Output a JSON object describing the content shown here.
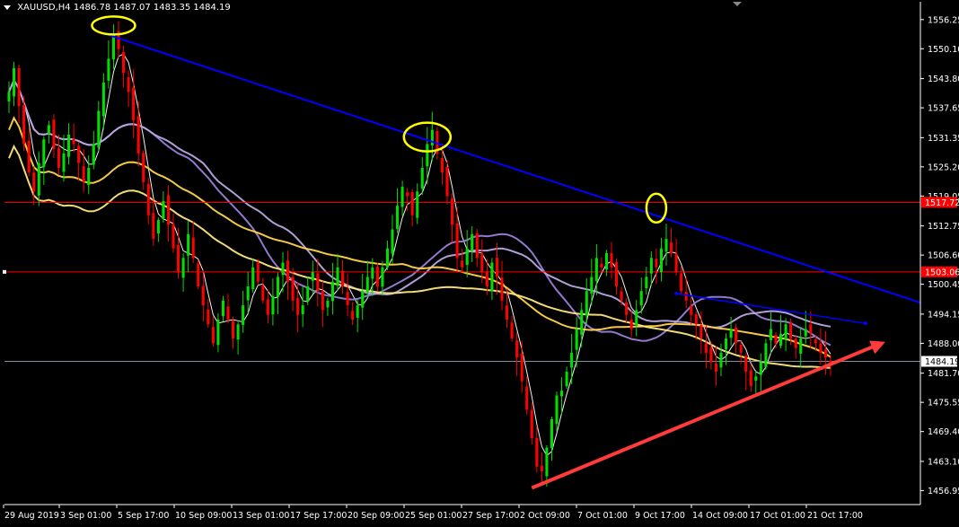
{
  "header": {
    "symbol": "XAUUSD,H4",
    "quote": "1486.78 1487.07 1483.35 1484.19"
  },
  "colors": {
    "background": "#000000",
    "axis": "#ffffff",
    "bull_candle": "#00e000",
    "bear_candle": "#ff0000",
    "resistance_line": "#0000ff",
    "support_arrow": "#ff3b3b",
    "horizontal_level": "#ff0000",
    "current_price_line": "#7f8c9c",
    "highlight_ellipse": "#ffff00",
    "ma_fast": "#ffffff",
    "ma_purple": "#9b7fd8",
    "ma_lavender": "#b9a8e0",
    "ma_gold": "#ffd54a",
    "ma_yellow": "#ffe680"
  },
  "chart_data": {
    "type": "candlestick",
    "symbol": "XAUUSD",
    "timeframe": "H4",
    "ylim": [
      1454.0,
      1560.0
    ],
    "y_ticks": [
      "1556.25",
      "1550.10",
      "1543.80",
      "1537.65",
      "1531.35",
      "1525.20",
      "1519.05",
      "1512.75",
      "1506.60",
      "1500.45",
      "1494.15",
      "1488.00",
      "1481.70",
      "1475.55",
      "1469.40",
      "1463.10",
      "1456.95"
    ],
    "x_ticks": [
      "29 Aug 2019",
      "3 Sep 01:00",
      "5 Sep 17:00",
      "10 Sep 09:00",
      "13 Sep 01:00",
      "17 Sep 17:00",
      "20 Sep 09:00",
      "25 Sep 01:00",
      "27 Sep 17:00",
      "2 Oct 09:00",
      "7 Oct 01:00",
      "9 Oct 17:00",
      "14 Oct 09:00",
      "17 Oct 01:00",
      "21 Oct 17:00"
    ],
    "level_labels": [
      "1517.72",
      "1503.06",
      "1484.19"
    ],
    "levels": [
      1517.72,
      1503.06
    ],
    "current_price": 1484.19,
    "closes": [
      1541,
      1546,
      1538,
      1530,
      1524,
      1520,
      1526,
      1531,
      1534,
      1529,
      1525,
      1528,
      1532,
      1530,
      1526,
      1522,
      1525,
      1530,
      1537,
      1543,
      1548,
      1553,
      1550,
      1545,
      1541,
      1535,
      1528,
      1522,
      1515,
      1510,
      1514,
      1518,
      1513,
      1508,
      1503,
      1506,
      1511,
      1506,
      1500,
      1496,
      1492,
      1488,
      1493,
      1497,
      1493,
      1489,
      1492,
      1496,
      1500,
      1504,
      1501,
      1497,
      1494,
      1498,
      1502,
      1505,
      1501,
      1497,
      1494,
      1496,
      1500,
      1503,
      1499,
      1495,
      1497,
      1501,
      1504,
      1500,
      1496,
      1493,
      1496,
      1499,
      1502,
      1504,
      1500,
      1504,
      1508,
      1512,
      1517,
      1521,
      1519,
      1515,
      1520,
      1525,
      1530,
      1533,
      1528,
      1524,
      1519,
      1513,
      1506,
      1504,
      1508,
      1511,
      1506,
      1503,
      1500,
      1505,
      1502,
      1497,
      1493,
      1489,
      1485,
      1480,
      1474,
      1468,
      1462,
      1461,
      1466,
      1472,
      1477,
      1478,
      1482,
      1486,
      1491,
      1495,
      1499,
      1502,
      1506,
      1504,
      1507,
      1504,
      1500,
      1497,
      1494,
      1491,
      1495,
      1499,
      1502,
      1506,
      1504,
      1508,
      1510,
      1507,
      1503,
      1499,
      1497,
      1494,
      1492,
      1489,
      1486,
      1484,
      1482,
      1486,
      1489,
      1491,
      1488,
      1486,
      1482,
      1479,
      1481,
      1484,
      1488,
      1491,
      1488,
      1490,
      1492,
      1489,
      1487,
      1489,
      1491,
      1490,
      1488,
      1486,
      1485,
      1484
    ],
    "moving_averages": [
      {
        "name": "",
        "color_key": "ma_fast"
      },
      {
        "name": "",
        "color_key": "ma_purple"
      },
      {
        "name": "",
        "color_key": "ma_lavender"
      },
      {
        "name": "",
        "color_key": "ma_gold"
      },
      {
        "name": "",
        "color_key": "ma_yellow"
      }
    ],
    "trendlines": [
      {
        "kind": "resistance",
        "from": "3 Sep 01:00",
        "to": "21 Oct 17:00",
        "color_key": "resistance_line"
      },
      {
        "kind": "support_arrow",
        "from": "27 Sep 17:00",
        "to": "21 Oct 17:00",
        "color_key": "support_arrow"
      }
    ],
    "highlighted_highs": [
      "3 Sep 01:00",
      "25 Sep 01:00",
      "9 Oct 17:00"
    ],
    "grid": false
  }
}
